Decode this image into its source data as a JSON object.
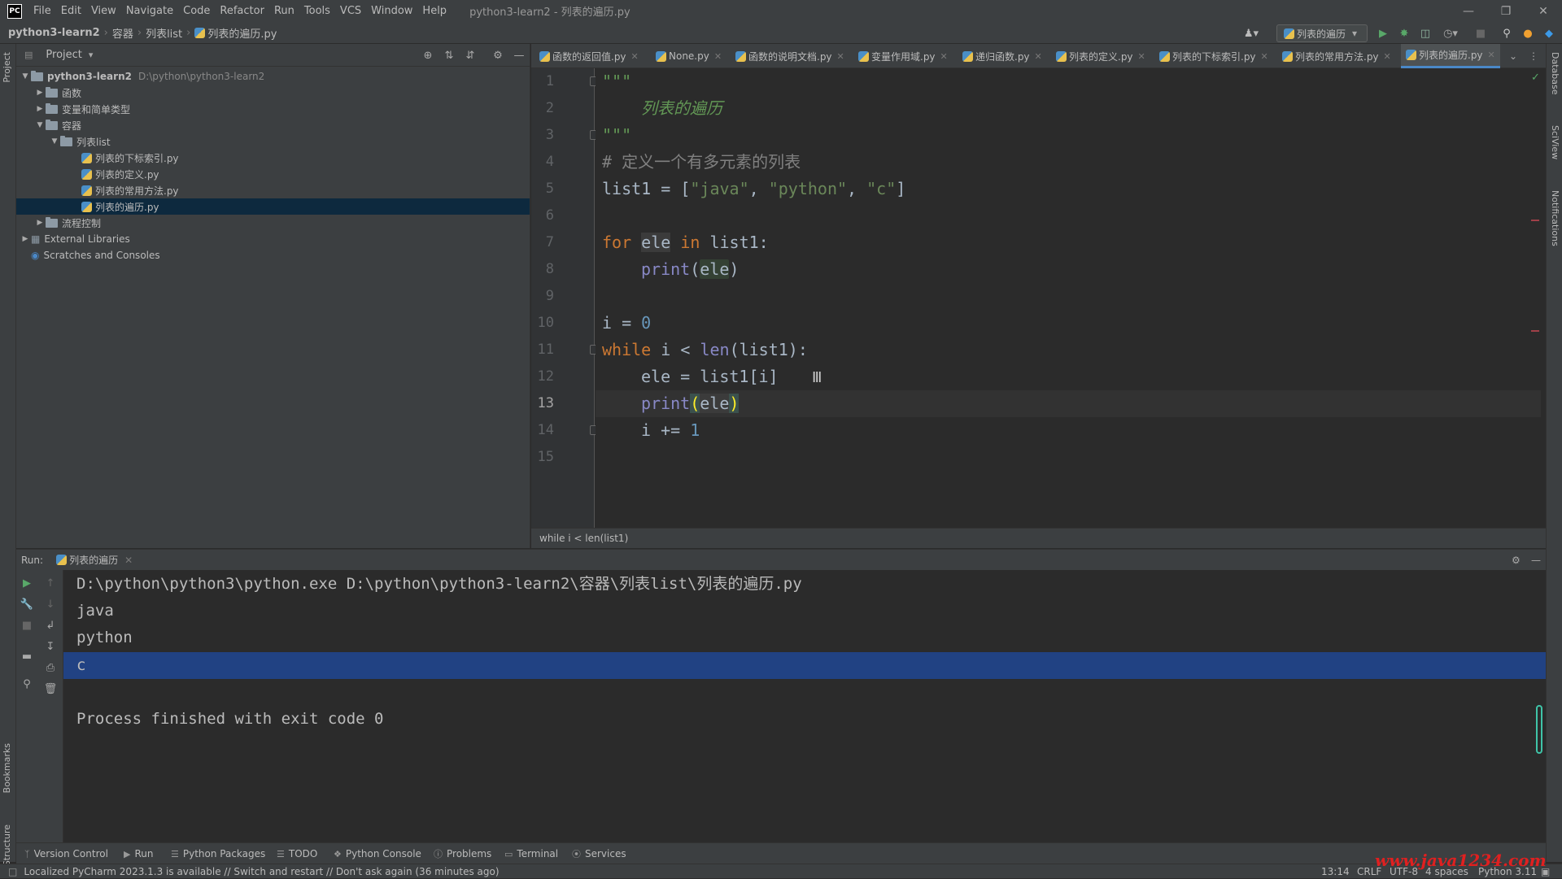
{
  "window": {
    "title": "python3-learn2 - 列表的遍历.py",
    "logo": "PC",
    "menu": [
      "File",
      "Edit",
      "View",
      "Navigate",
      "Code",
      "Refactor",
      "Run",
      "Tools",
      "VCS",
      "Window",
      "Help"
    ]
  },
  "breadcrumbs": [
    "python3-learn2",
    "容器",
    "列表list",
    "列表的遍历.py"
  ],
  "run_config": "列表的遍历",
  "project_panel": {
    "title": "Project",
    "tree": [
      {
        "label": "python3-learn2",
        "path": "D:\\python\\python3-learn2",
        "expanded": true
      },
      {
        "label": "函数",
        "expanded": false
      },
      {
        "label": "变量和简单类型",
        "expanded": false
      },
      {
        "label": "容器",
        "expanded": true
      },
      {
        "label": "列表list",
        "expanded": true
      },
      {
        "label": "列表的下标索引.py"
      },
      {
        "label": "列表的定义.py"
      },
      {
        "label": "列表的常用方法.py"
      },
      {
        "label": "列表的遍历.py",
        "selected": true
      },
      {
        "label": "流程控制",
        "expanded": false
      },
      {
        "label": "External Libraries",
        "expanded": false
      },
      {
        "label": "Scratches and Consoles"
      }
    ]
  },
  "editor_tabs": [
    "函数的返回值.py",
    "None.py",
    "函数的说明文档.py",
    "变量作用域.py",
    "递归函数.py",
    "列表的定义.py",
    "列表的下标索引.py",
    "列表的常用方法.py",
    "列表的遍历.py"
  ],
  "active_tab": "列表的遍历.py",
  "code": {
    "line_numbers": [
      "1",
      "2",
      "3",
      "4",
      "5",
      "6",
      "7",
      "8",
      "9",
      "10",
      "11",
      "12",
      "13",
      "14",
      "15"
    ],
    "current_line": 13,
    "l1": "\"\"\"",
    "l2": "列表的遍历",
    "l3": "\"\"\"",
    "l4": "# 定义一个有多元素的列表",
    "l5_a": "list1 = [",
    "l5_s1": "\"java\"",
    "l5_c1": ", ",
    "l5_s2": "\"python\"",
    "l5_c2": ", ",
    "l5_s3": "\"c\"",
    "l5_e": "]",
    "l7_kw1": "for",
    "l7_v": "ele",
    "l7_kw2": "in",
    "l7_rest": " list1:",
    "l8_fn": "print",
    "l8_p1": "(",
    "l8_v": "ele",
    "l8_p2": ")",
    "l10_a": "i = ",
    "l10_n": "0",
    "l11_kw": "while",
    "l11_a": " i < ",
    "l11_fn": "len",
    "l11_b": "(list1):",
    "l12": "ele = list1[i]",
    "l13_fn": "print",
    "l13_p1": "(",
    "l13_v": "ele",
    "l13_p2": ")",
    "l14_a": "i += ",
    "l14_n": "1"
  },
  "editor_breadcrumb": "while i < len(list1)",
  "run_panel": {
    "label": "Run:",
    "tab": "列表的遍历",
    "output": [
      "D:\\python\\python3\\python.exe D:\\python\\python3-learn2\\容器\\列表list\\列表的遍历.py",
      "java",
      "python",
      "c",
      "",
      "Process finished with exit code 0"
    ]
  },
  "tool_windows": [
    "Version Control",
    "Run",
    "Python Packages",
    "TODO",
    "Python Console",
    "Problems",
    "Terminal",
    "Services"
  ],
  "left_stripe": [
    "Project",
    "Bookmarks",
    "Structure"
  ],
  "right_stripe": [
    "Database",
    "SciView",
    "Notifications"
  ],
  "status": {
    "message": "Localized PyCharm 2023.1.3 is available // Switch and restart // Don't ask again (36 minutes ago)",
    "position": "13:14",
    "line_sep": "CRLF",
    "encoding": "UTF-8",
    "indent": "4 spaces",
    "interpreter": "Python 3.11"
  },
  "watermark": "www.java1234.com"
}
